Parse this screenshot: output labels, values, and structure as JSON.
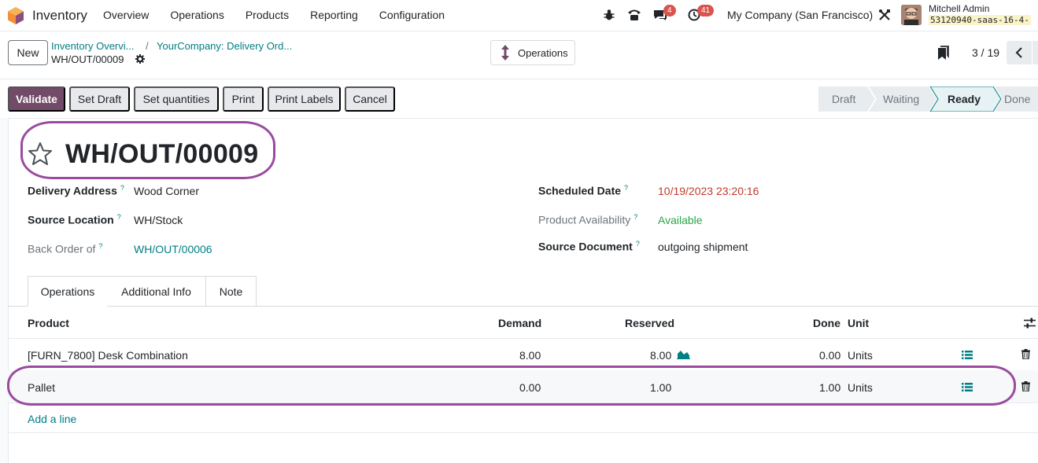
{
  "app": {
    "name": "Inventory"
  },
  "menu": [
    "Overview",
    "Operations",
    "Products",
    "Reporting",
    "Configuration"
  ],
  "systray": {
    "messages_count": "4",
    "activities_count": "41",
    "company": "My Company (San Francisco)",
    "user_name": "Mitchell Admin",
    "database": "53120940-saas-16-4-"
  },
  "control": {
    "new_label": "New",
    "breadcrumb": [
      "Inventory Overvi...",
      "YourCompany: Delivery Ord..."
    ],
    "record_ref": "WH/OUT/00009",
    "operations_label": "Operations",
    "pager": "3 / 19"
  },
  "actions": [
    "Validate",
    "Set Draft",
    "Set quantities",
    "Print",
    "Print Labels",
    "Cancel"
  ],
  "stages": [
    "Draft",
    "Waiting",
    "Ready",
    "Done"
  ],
  "record": {
    "title": "WH/OUT/00009",
    "fields": {
      "delivery_address": {
        "label": "Delivery Address",
        "value": "Wood Corner"
      },
      "source_location": {
        "label": "Source Location",
        "value": "WH/Stock"
      },
      "back_order": {
        "label": "Back Order of",
        "value": "WH/OUT/00006"
      },
      "scheduled_date": {
        "label": "Scheduled Date",
        "value": "10/19/2023 23:20:16"
      },
      "availability": {
        "label": "Product Availability",
        "value": "Available"
      },
      "source_document": {
        "label": "Source Document",
        "value": "outgoing shipment"
      }
    },
    "help": "?"
  },
  "tabs": [
    "Operations",
    "Additional Info",
    "Note"
  ],
  "table": {
    "headers": {
      "product": "Product",
      "demand": "Demand",
      "reserved": "Reserved",
      "done": "Done",
      "unit": "Unit"
    },
    "rows": [
      {
        "product": "[FURN_7800] Desk Combination",
        "demand": "8.00",
        "reserved": "8.00",
        "done": "0.00",
        "unit": "Units"
      },
      {
        "product": "Pallet",
        "demand": "0.00",
        "reserved": "1.00",
        "done": "1.00",
        "unit": "Units"
      }
    ],
    "add_line": "Add a line"
  },
  "colors": {
    "primary": "#714b67",
    "link": "#017e84",
    "highlight": "#9b4aa0",
    "danger": "#c0392b",
    "success": "#28a745"
  }
}
